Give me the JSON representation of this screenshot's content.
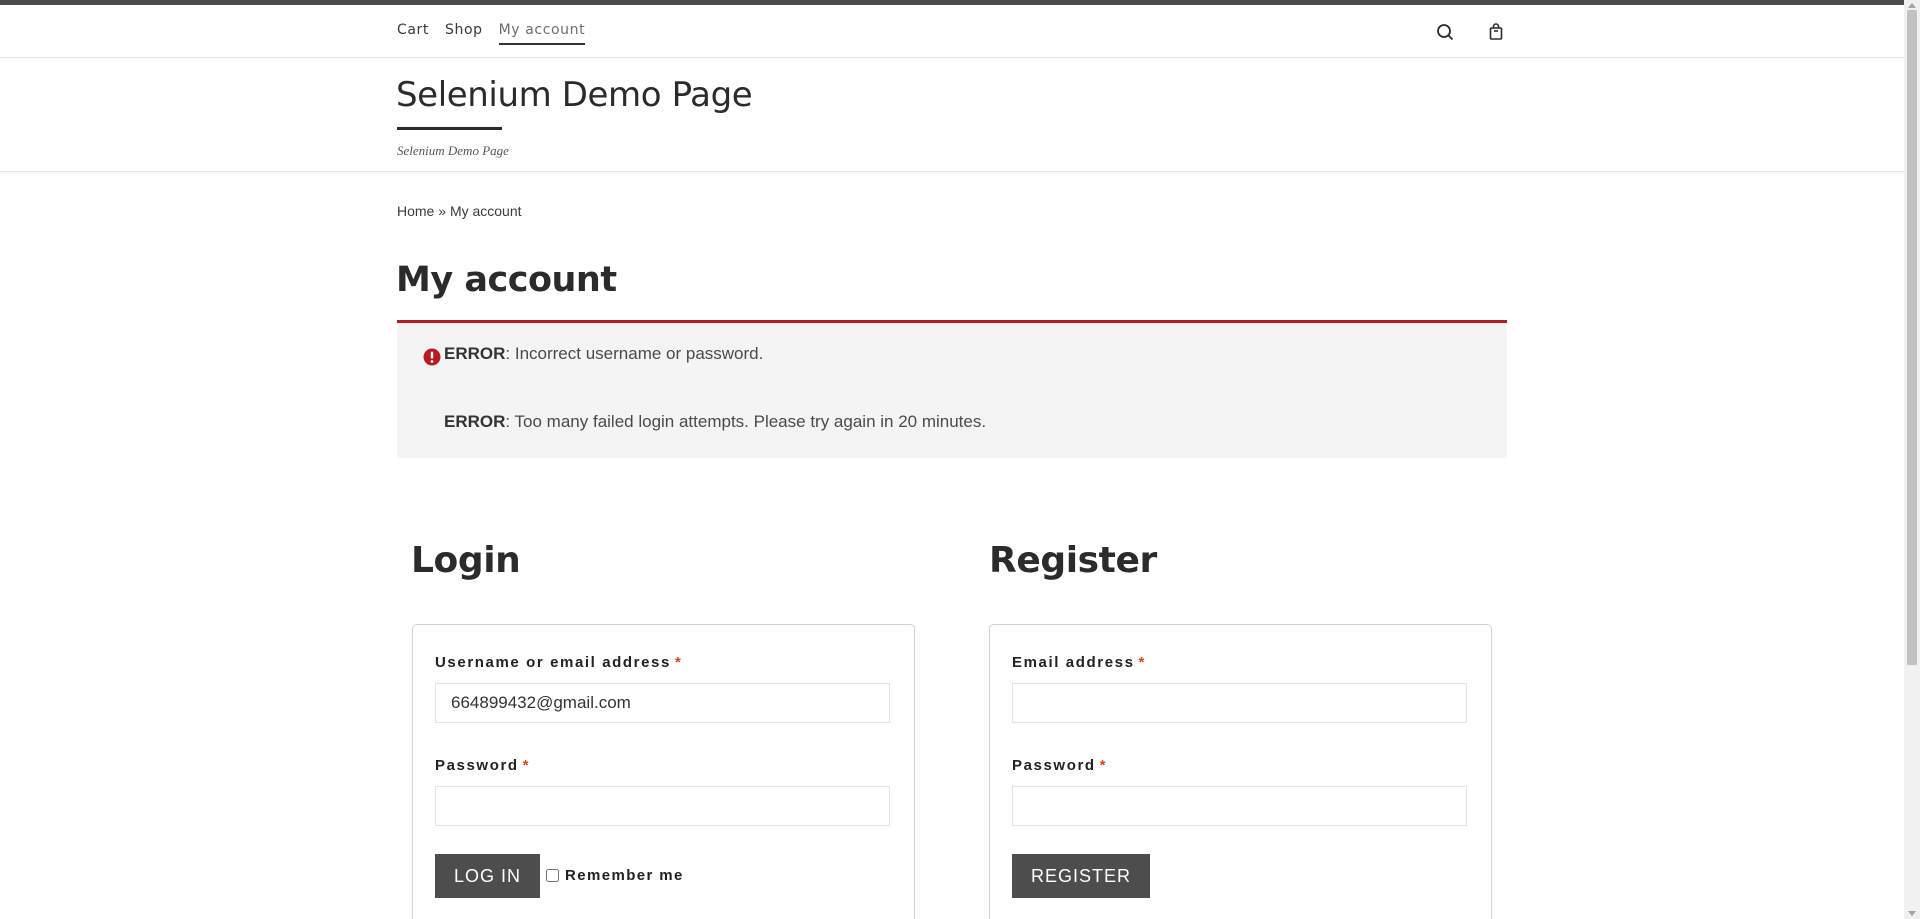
{
  "nav": {
    "items": [
      {
        "label": "Cart",
        "active": false
      },
      {
        "label": "Shop",
        "active": false
      },
      {
        "label": "My account",
        "active": true
      }
    ],
    "icons": [
      "search-icon",
      "shopping-bag-icon"
    ]
  },
  "site": {
    "title": "Selenium Demo Page",
    "tagline": "Selenium Demo Page"
  },
  "breadcrumb": {
    "home": "Home",
    "separator": " » ",
    "current": "My account"
  },
  "page": {
    "title": "My account"
  },
  "errors": [
    {
      "label": "ERROR",
      "message": ": Incorrect username or password."
    },
    {
      "label": "ERROR",
      "message": ": Too many failed login attempts. Please try again in 20 minutes."
    }
  ],
  "login": {
    "heading": "Login",
    "username_label": "Username or email address",
    "username_value": "664899432@gmail.com",
    "password_label": "Password",
    "password_value": "",
    "required_mark": "*",
    "submit_label": "LOG IN",
    "remember_label": "Remember me",
    "remember_checked": false
  },
  "register": {
    "heading": "Register",
    "email_label": "Email address",
    "email_value": "",
    "password_label": "Password",
    "password_value": "",
    "required_mark": "*",
    "submit_label": "REGISTER"
  },
  "colors": {
    "error_accent": "#b81c23",
    "button_bg": "#4d4d4d",
    "required": "#e2401c"
  }
}
